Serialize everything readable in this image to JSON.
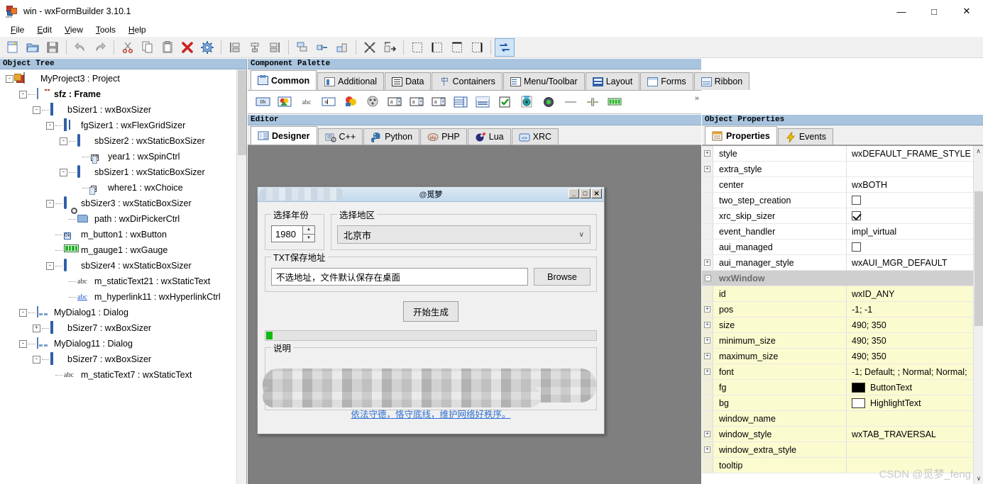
{
  "window": {
    "title": "win - wxFormBuilder 3.10.1",
    "app_icon": "wxfb-icon",
    "controls": {
      "minimize": "—",
      "maximize": "□",
      "close": "✕"
    }
  },
  "menubar": {
    "items": [
      {
        "label": "File",
        "mnemonic": "F"
      },
      {
        "label": "Edit",
        "mnemonic": "E"
      },
      {
        "label": "View",
        "mnemonic": "V"
      },
      {
        "label": "Tools",
        "mnemonic": "T"
      },
      {
        "label": "Help",
        "mnemonic": "H"
      }
    ]
  },
  "toolbar": {
    "groups": [
      [
        "new-icon",
        "open-icon",
        "save-icon"
      ],
      [
        "undo-icon",
        "redo-icon"
      ],
      [
        "cut-icon",
        "copy-icon",
        "paste-icon",
        "delete-icon",
        "settings-icon"
      ],
      [
        "align-left-icon",
        "align-center-icon",
        "align-right-icon"
      ],
      [
        "align-top-icon",
        "align-middle-icon",
        "align-bottom-icon"
      ],
      [
        "expand-icon",
        "stretch-icon"
      ],
      [
        "border-none-icon",
        "border-left-icon",
        "border-top-icon",
        "border-right-icon"
      ],
      [
        "toggle-orientation-icon"
      ]
    ]
  },
  "object_tree": {
    "caption": "Object Tree",
    "nodes": [
      {
        "label": "MyProject3 : Project",
        "indent": 0,
        "expander": "-",
        "icon": "project-icon",
        "selected": false
      },
      {
        "label": "sfz : Frame",
        "indent": 1,
        "expander": "-",
        "icon": "frame-icon",
        "selected": true
      },
      {
        "label": "bSizer1 : wxBoxSizer",
        "indent": 2,
        "expander": "-",
        "icon": "boxsizer-icon",
        "selected": false
      },
      {
        "label": "fgSizer1 : wxFlexGridSizer",
        "indent": 3,
        "expander": "-",
        "icon": "flexgridsizer-icon",
        "selected": false
      },
      {
        "label": "sbSizer2 : wxStaticBoxSizer",
        "indent": 4,
        "expander": "-",
        "icon": "staticboxsizer-icon",
        "selected": false
      },
      {
        "label": "year1 : wxSpinCtrl",
        "indent": 5,
        "expander": "",
        "icon": "spinctrl-icon",
        "selected": false
      },
      {
        "label": "sbSizer1 : wxStaticBoxSizer",
        "indent": 4,
        "expander": "-",
        "icon": "staticboxsizer-icon",
        "selected": false
      },
      {
        "label": "where1 : wxChoice",
        "indent": 5,
        "expander": "",
        "icon": "choice-icon",
        "selected": false
      },
      {
        "label": "sbSizer3 : wxStaticBoxSizer",
        "indent": 3,
        "expander": "-",
        "icon": "staticboxsizer-icon",
        "selected": false
      },
      {
        "label": "path : wxDirPickerCtrl",
        "indent": 4,
        "expander": "",
        "icon": "dirpicker-icon",
        "selected": false
      },
      {
        "label": "m_button1 : wxButton",
        "indent": 3,
        "expander": "",
        "icon": "button-icon",
        "selected": false
      },
      {
        "label": "m_gauge1 : wxGauge",
        "indent": 3,
        "expander": "",
        "icon": "gauge-icon",
        "selected": false
      },
      {
        "label": "sbSizer4 : wxStaticBoxSizer",
        "indent": 3,
        "expander": "-",
        "icon": "staticboxsizer-icon",
        "selected": false
      },
      {
        "label": "m_staticText21 : wxStaticText",
        "indent": 4,
        "expander": "",
        "icon": "statictext-icon",
        "selected": false
      },
      {
        "label": "m_hyperlink11 : wxHyperlinkCtrl",
        "indent": 4,
        "expander": "",
        "icon": "hyperlink-icon",
        "selected": false
      },
      {
        "label": "MyDialog1 : Dialog",
        "indent": 1,
        "expander": "-",
        "icon": "dialog-icon",
        "selected": false
      },
      {
        "label": "bSizer7 : wxBoxSizer",
        "indent": 2,
        "expander": "+",
        "icon": "boxsizer-icon",
        "selected": false
      },
      {
        "label": "MyDialog11 : Dialog",
        "indent": 1,
        "expander": "-",
        "icon": "dialog-icon",
        "selected": false
      },
      {
        "label": "bSizer7 : wxBoxSizer",
        "indent": 2,
        "expander": "-",
        "icon": "boxsizer-icon",
        "selected": false
      },
      {
        "label": "m_staticText7 : wxStaticText",
        "indent": 3,
        "expander": "",
        "icon": "statictext-icon",
        "selected": false
      }
    ]
  },
  "palette": {
    "caption": "Component Palette",
    "tabs": [
      {
        "label": "Common",
        "icon": "common-tab-icon",
        "active": true
      },
      {
        "label": "Additional",
        "icon": "additional-tab-icon",
        "active": false
      },
      {
        "label": "Data",
        "icon": "data-tab-icon",
        "active": false
      },
      {
        "label": "Containers",
        "icon": "containers-tab-icon",
        "active": false
      },
      {
        "label": "Menu/Toolbar",
        "icon": "menutoolbar-tab-icon",
        "active": false
      },
      {
        "label": "Layout",
        "icon": "layout-tab-icon",
        "active": false
      },
      {
        "label": "Forms",
        "icon": "forms-tab-icon",
        "active": false
      },
      {
        "label": "Ribbon",
        "icon": "ribbon-tab-icon",
        "active": false
      }
    ],
    "widgets": [
      "wxbutton-icon",
      "wxbitmapbutton-icon",
      "wxstatictext-icon",
      "wxtextctrl-icon",
      "wxstaticbitmap-icon",
      "wxradiobutton-group-icon",
      "wxcombobox-icon",
      "wxchoice-icon",
      "wxlistbox-icon",
      "wxlistctrl-icon",
      "wxcheckbox-icon",
      "wxcheckbox2-icon",
      "wxradiobox-icon",
      "wxradiobutton-icon",
      "wxstaticline-icon",
      "wxslider-icon",
      "wxgauge-icon"
    ],
    "overflow": "»"
  },
  "editor": {
    "caption": "Editor",
    "tabs": [
      {
        "label": "Designer",
        "icon": "designer-tab-icon",
        "active": true
      },
      {
        "label": "C++",
        "icon": "cpp-tab-icon",
        "active": false
      },
      {
        "label": "Python",
        "icon": "python-tab-icon",
        "active": false
      },
      {
        "label": "PHP",
        "icon": "php-tab-icon",
        "active": false
      },
      {
        "label": "Lua",
        "icon": "lua-tab-icon",
        "active": false
      },
      {
        "label": "XRC",
        "icon": "xrc-tab-icon",
        "active": false
      }
    ]
  },
  "preview": {
    "title": "@觅梦",
    "title_censored": true,
    "buttons": {
      "minimize": "_",
      "maximize": "□",
      "close": "✕"
    },
    "year_group": {
      "legend": "选择年份",
      "value": "1980",
      "up": "▲",
      "down": "▼"
    },
    "area_group": {
      "legend": "选择地区",
      "value": "北京市",
      "chevron": "∨"
    },
    "path_group": {
      "legend": "TXT保存地址",
      "value": "不选地址，文件默认保存在桌面",
      "browse": "Browse"
    },
    "generate_button": "开始生成",
    "gauge": {
      "value": 2
    },
    "desc_group": {
      "legend": "说明",
      "body_censored": true,
      "link": "依法守德，恪守底线，维护网络好秩序。"
    }
  },
  "properties": {
    "caption": "Object Properties",
    "tabs": [
      {
        "label": "Properties",
        "icon": "properties-tab-icon",
        "active": true
      },
      {
        "label": "Events",
        "icon": "events-tab-icon",
        "active": false
      }
    ],
    "rows": [
      {
        "expander": "+",
        "name": "style",
        "value": "wxDEFAULT_FRAME_STYLE",
        "type": "text",
        "category": false,
        "highlight": false
      },
      {
        "expander": "+",
        "name": "extra_style",
        "value": "",
        "type": "text",
        "category": false,
        "highlight": false
      },
      {
        "expander": "",
        "name": "center",
        "value": "wxBOTH",
        "type": "text",
        "category": false,
        "highlight": false
      },
      {
        "expander": "",
        "name": "two_step_creation",
        "value": "",
        "type": "checkbox",
        "checked": false,
        "category": false,
        "highlight": false
      },
      {
        "expander": "",
        "name": "xrc_skip_sizer",
        "value": "",
        "type": "checkbox",
        "checked": true,
        "category": false,
        "highlight": false
      },
      {
        "expander": "",
        "name": "event_handler",
        "value": "impl_virtual",
        "type": "text",
        "category": false,
        "highlight": false
      },
      {
        "expander": "",
        "name": "aui_managed",
        "value": "",
        "type": "checkbox",
        "checked": false,
        "category": false,
        "highlight": false
      },
      {
        "expander": "+",
        "name": "aui_manager_style",
        "value": "wxAUI_MGR_DEFAULT",
        "type": "text",
        "category": false,
        "highlight": false
      },
      {
        "expander": "-",
        "name": "wxWindow",
        "value": "",
        "type": "text",
        "category": true,
        "highlight": false
      },
      {
        "expander": "",
        "name": "id",
        "value": "wxID_ANY",
        "type": "text",
        "category": false,
        "highlight": true
      },
      {
        "expander": "+",
        "name": "pos",
        "value": "-1; -1",
        "type": "text",
        "category": false,
        "highlight": true
      },
      {
        "expander": "+",
        "name": "size",
        "value": "490; 350",
        "type": "text",
        "category": false,
        "highlight": true
      },
      {
        "expander": "+",
        "name": "minimum_size",
        "value": "490; 350",
        "type": "text",
        "category": false,
        "highlight": true
      },
      {
        "expander": "+",
        "name": "maximum_size",
        "value": "490; 350",
        "type": "text",
        "category": false,
        "highlight": true
      },
      {
        "expander": "+",
        "name": "font",
        "value": "-1; Default; ; Normal; Normal;",
        "type": "text",
        "category": false,
        "highlight": true
      },
      {
        "expander": "",
        "name": "fg",
        "value": "ButtonText",
        "type": "color",
        "color": "#000000",
        "category": false,
        "highlight": true
      },
      {
        "expander": "",
        "name": "bg",
        "value": "HighlightText",
        "type": "color",
        "color": "#ffffff",
        "category": false,
        "highlight": true
      },
      {
        "expander": "",
        "name": "window_name",
        "value": "",
        "type": "text",
        "category": false,
        "highlight": true
      },
      {
        "expander": "+",
        "name": "window_style",
        "value": "wxTAB_TRAVERSAL",
        "type": "text",
        "category": false,
        "highlight": true
      },
      {
        "expander": "+",
        "name": "window_extra_style",
        "value": "",
        "type": "text",
        "category": false,
        "highlight": true
      },
      {
        "expander": "",
        "name": "tooltip",
        "value": "",
        "type": "text",
        "category": false,
        "highlight": true
      }
    ],
    "scroll": {
      "up": "∧",
      "down": "∨"
    }
  },
  "watermark": "CSDN @觅梦_feng"
}
